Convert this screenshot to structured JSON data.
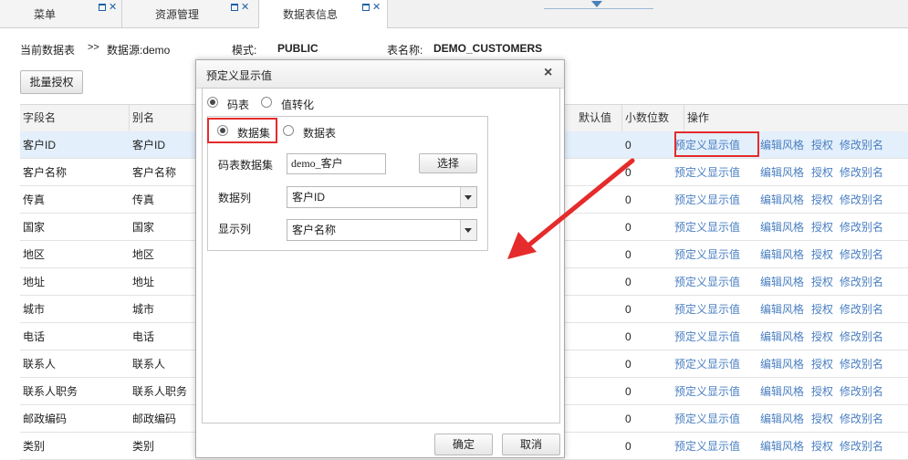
{
  "tabs": [
    {
      "label": "菜单"
    },
    {
      "label": "资源管理"
    },
    {
      "label": "数据表信息"
    }
  ],
  "info": {
    "current_label": "当前数据表",
    "path_sep": ">>",
    "datasource": "数据源:demo",
    "mode_label": "模式:",
    "mode_value": "PUBLIC",
    "table_label": "表名称:",
    "table_value": "DEMO_CUSTOMERS"
  },
  "batch_button": "批量授权",
  "grid": {
    "headers": [
      "字段名",
      "别名",
      "默认值",
      "小数位数",
      "操作"
    ],
    "rows": [
      {
        "field": "客户ID",
        "alias": "客户ID",
        "decimals": "0"
      },
      {
        "field": "客户名称",
        "alias": "客户名称",
        "decimals": "0"
      },
      {
        "field": "传真",
        "alias": "传真",
        "decimals": "0"
      },
      {
        "field": "国家",
        "alias": "国家",
        "decimals": "0"
      },
      {
        "field": "地区",
        "alias": "地区",
        "decimals": "0"
      },
      {
        "field": "地址",
        "alias": "地址",
        "decimals": "0"
      },
      {
        "field": "城市",
        "alias": "城市",
        "decimals": "0"
      },
      {
        "field": "电话",
        "alias": "电话",
        "decimals": "0"
      },
      {
        "field": "联系人",
        "alias": "联系人",
        "decimals": "0"
      },
      {
        "field": "联系人职务",
        "alias": "联系人职务",
        "decimals": "0"
      },
      {
        "field": "邮政编码",
        "alias": "邮政编码",
        "decimals": "0"
      },
      {
        "field": "类别",
        "alias": "类别",
        "decimals": "0"
      }
    ],
    "actions": [
      "预定义显示值",
      "编辑风格",
      "授权",
      "修改别名"
    ]
  },
  "dialog": {
    "title": "预定义显示值",
    "close": "×",
    "mode_options": [
      "码表",
      "值转化"
    ],
    "source_options": [
      "数据集",
      "数据表"
    ],
    "dataset_label": "码表数据集",
    "dataset_value": "demo_客户",
    "choose_button": "选择",
    "data_col_label": "数据列",
    "data_col_value": "客户ID",
    "display_col_label": "显示列",
    "display_col_value": "客户名称",
    "ok_button": "确定",
    "cancel_button": "取消"
  },
  "colors": {
    "annotation_red": "#e52b2b",
    "link_blue": "#4a7fc2",
    "selected_row": "#e3effb"
  }
}
